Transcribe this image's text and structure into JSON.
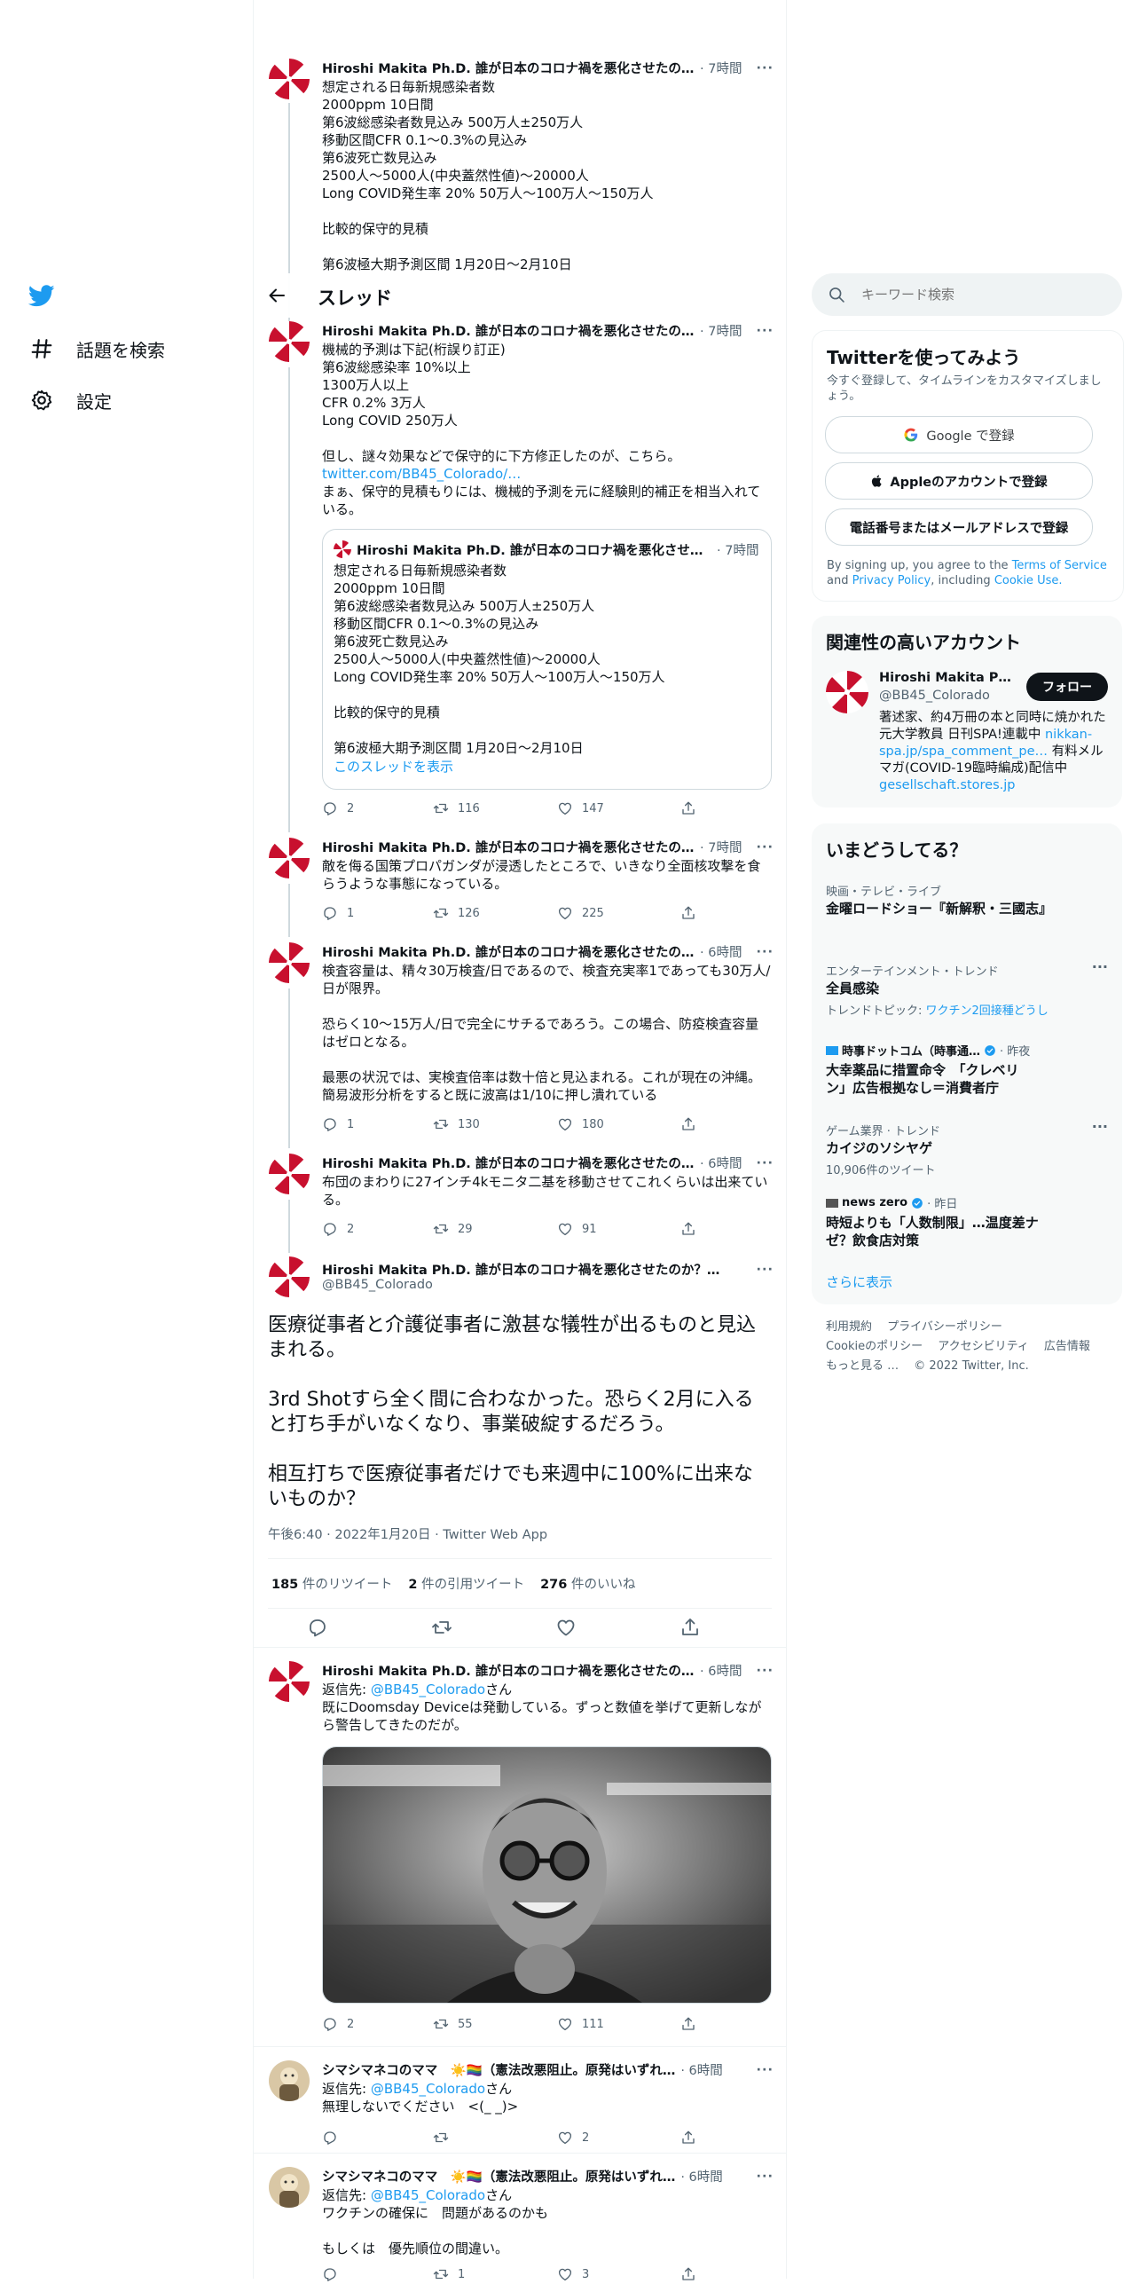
{
  "nav": {
    "explore_label": "話題を検索",
    "settings_label": "設定"
  },
  "thread_header": {
    "title": "スレッド"
  },
  "author": {
    "name": "Hiroshi Makita Ph.D. 誰が日本のコロナ禍を悪化させたのか…",
    "name_full": "Hiroshi Makita Ph.D. 誰が日本のコロナ禍を悪化させたのか？扶桑…",
    "handle": "@BB45_Colorado"
  },
  "tweets": [
    {
      "time": "· 7時間",
      "text": "想定される日毎新規感染者数\n2000ppm 10日間\n第6波総感染者数見込み 500万人±250万人\n移動区間CFR 0.1〜0.3%の見込み\n第6波死亡数見込み\n2500人〜5000人(中央蓋然性値)〜20000人\nLong COVID発生率 20% 50万人〜100万人〜150万人\n\n比較的保守的見積\n\n第6波極大期予測区間 1月20日〜2月10日"
    },
    {
      "time": "· 7時間",
      "text": "機械的予測は下記(桁誤り訂正)\n第6波総感染率 10%以上\n1300万人以上\nCFR 0.2% 3万人\nLong COVID 250万人\n\n但し、謎々効果などで保守的に下方修正したのが、こちら。",
      "link": "twitter.com/BB45_Colorado/…",
      "text2": "まぁ、保守的見積もりには、機械的予測を元に経験則的補正を相当入れている。",
      "quote": {
        "name": "Hiroshi Makita Ph.D. 誰が日本のコロナ禍を悪化させたの…",
        "time": "· 7時間",
        "text": "想定される日毎新規感染者数\n2000ppm 10日間\n第6波総感染者数見込み 500万人±250万人\n移動区間CFR 0.1〜0.3%の見込み\n第6波死亡数見込み\n2500人〜5000人(中央蓋然性値)〜20000人\nLong COVID発生率 20% 50万人〜100万人〜150万人\n\n比較的保守的見積\n\n第6波極大期予測区間 1月20日〜2月10日",
        "show_thread": "このスレッドを表示"
      },
      "replies": "2",
      "retweets": "116",
      "likes": "147"
    },
    {
      "time": "· 7時間",
      "text": "敵を侮る国策プロパガンダが浸透したところで、いきなり全面核攻撃を食らうような事態になっている。",
      "replies": "1",
      "retweets": "126",
      "likes": "225"
    },
    {
      "time": "· 6時間",
      "text": "検査容量は、精々30万検査/日であるので、検査充実率1であっても30万人/日が限界。\n\n恐らく10〜15万人/日で完全にサチるであろう。この場合、防疫検査容量はゼロとなる。\n\n最悪の状況では、実検査倍率は数十倍と見込まれる。これが現在の沖縄。簡易波形分析をすると既に波高は1/10に押し潰れている",
      "replies": "1",
      "retweets": "130",
      "likes": "180"
    },
    {
      "time": "· 6時間",
      "text": "布団のまわりに27インチ4kモニタ二基を移動させてこれくらいは出来ている。",
      "replies": "2",
      "retweets": "29",
      "likes": "91"
    }
  ],
  "main_tweet": {
    "text": "医療従事者と介護従事者に激甚な犠牲が出るものと見込まれる。\n\n3rd Shotすら全く間に合わなかった。恐らく2月に入ると打ち手がいなくなり、事業破綻するだろう。\n\n相互打ちで医療従事者だけでも来週中に100%に出来ないものか？",
    "meta": "午後6:40 · 2022年1月20日 · Twitter Web App",
    "retweets_num": "185",
    "retweets_label": " 件のリツイート",
    "quotes_num": "2",
    "quotes_label": " 件の引用ツイート",
    "likes_num": "276",
    "likes_label": " 件のいいね"
  },
  "replies": [
    {
      "name": "Hiroshi Makita Ph.D. 誰が日本のコロナ禍を悪化させたのか…",
      "time": "· 6時間",
      "reply_to_prefix": "返信先: ",
      "reply_to": "@BB45_Colorado",
      "reply_to_suffix": "さん",
      "text": "既にDoomsday Deviceは発動している。ずっと数値を挙げて更新しながら警告してきたのだが。",
      "replies": "2",
      "retweets": "55",
      "likes": "111"
    },
    {
      "name": "シマシマネコのママ　☀️🏳️‍🌈（憲法改悪阻止。原発はいずれ…",
      "time": "· 6時間",
      "reply_to_prefix": "返信先: ",
      "reply_to": "@BB45_Colorado",
      "reply_to_suffix": "さん",
      "text": "無理しないでください　<(_ _)>",
      "replies": "",
      "retweets": "",
      "likes": "2"
    },
    {
      "name": "シマシマネコのママ　☀️🏳️‍🌈（憲法改悪阻止。原発はいずれ…",
      "time": "· 6時間",
      "reply_to_prefix": "返信先: ",
      "reply_to": "@BB45_Colorado",
      "reply_to_suffix": "さん",
      "text": "ワクチンの確保に　問題があるのかも\n\nもしくは　優先順位の間違い。",
      "replies": "",
      "retweets": "1",
      "likes": "3"
    }
  ],
  "sidebar": {
    "search_placeholder": "キーワード検索",
    "signup": {
      "title": "Twitterを使ってみよう",
      "subtitle": "今すぐ登録して、タイムラインをカスタマイズしましょう。",
      "google": "Google で登録",
      "apple": "Appleのアカウントで登録",
      "phone": "電話番号またはメールアドレスで登録",
      "terms_prefix": "By signing up, you agree to the ",
      "terms": "Terms of Service",
      "and": " and ",
      "privacy": "Privacy Policy",
      "including": ", including ",
      "cookie": "Cookie Use."
    },
    "related": {
      "title": "関連性の高いアカウント",
      "name": "Hiroshi Makita Ph.D. …",
      "handle": "@BB45_Colorado",
      "follow": "フォロー",
      "bio1": "著述家、約4万冊の本と同時に焼かれた元大学教員 日刊SPA!連載中",
      "bio_link": "nikkan-spa.jp/spa_comment_pe…",
      "bio2": " 有料メルマガ(COVID-19臨時編成)配信中 ",
      "bio_link2": "gesellschaft.stores.jp"
    },
    "trends": {
      "title": "いまどうしてる？",
      "items": [
        {
          "cat": "映画・テレビ・ライブ",
          "title": "金曜ロードショー『新解釈・三國志』"
        },
        {
          "cat": "エンターテインメント・トレンド",
          "title": "全員感染",
          "sub_prefix": "トレンドトピック: ",
          "sub_link": "ワクチン2回接種どうし"
        },
        {
          "source": "時事ドットコム（時事通…",
          "time": "· 昨夜",
          "title": "大幸薬品に措置命令　「クレベリン」広告根拠なし＝消費者庁"
        },
        {
          "cat": "ゲーム業界 · トレンド",
          "title": "カイジのソシヤゲ",
          "sub": "10,906件のツイート"
        },
        {
          "source": "news zero",
          "time": "· 昨日",
          "title": "時短よりも「人数制限」…温度差ナゼ？飲食店対策"
        }
      ],
      "more": "さらに表示"
    },
    "footer": {
      "terms": "利用規約",
      "privacy": "プライバシーポリシー",
      "cookie": "Cookieのポリシー",
      "accessibility": "アクセシビリティ",
      "ads": "広告情報",
      "more": "もっと見る …",
      "copyright": "© 2022 Twitter, Inc."
    }
  },
  "colors": {
    "accent": "#1d9bf0",
    "text": "#0f1419",
    "muted": "#536471",
    "border": "#eff3f4"
  },
  "icons": [
    "twitter-bird-icon",
    "hashtag-icon",
    "gear-icon",
    "back-arrow-icon",
    "search-icon",
    "reply-icon",
    "retweet-icon",
    "like-icon",
    "share-icon",
    "more-icon",
    "google-icon",
    "apple-icon",
    "verified-icon"
  ]
}
